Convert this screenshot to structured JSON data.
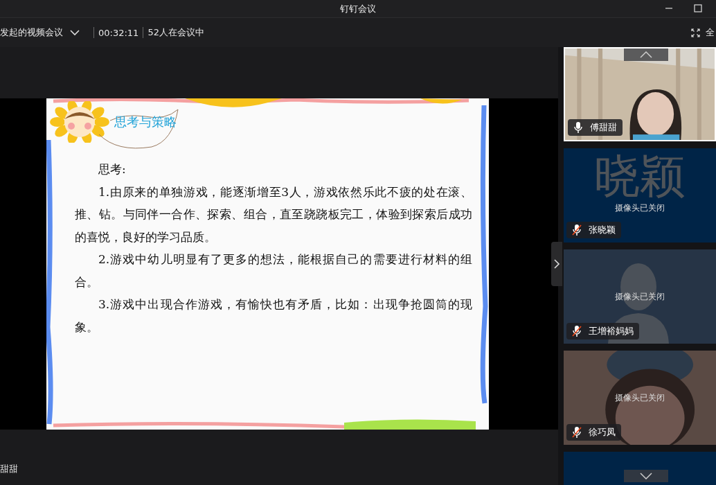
{
  "window": {
    "title": "钉钉会议"
  },
  "toolbar": {
    "meeting_name": "发起的视频会议",
    "duration": "00:32:11",
    "attendees": "52人在会议中",
    "fullscreen_label": "全"
  },
  "slide": {
    "heading": "思考与策略",
    "paragraphs": [
      {
        "text": "思考:"
      },
      {
        "text": "1.由原来的单独游戏，能逐渐增至3人，游戏依然乐此不疲的处在滚、推、钻。与同伴一合作、探索、组合，直至跷跷板完工，体验到探索后成功的喜悦，良好的学习品质。"
      },
      {
        "text": "2.游戏中幼儿明显有了更多的想法，能根据自己的需要进行材料的组合。"
      },
      {
        "text": "3.游戏中出现合作游戏，有愉快也有矛盾，比如：出现争抢圆筒的现象。"
      }
    ]
  },
  "speaker_label": "甜甜",
  "participants": [
    {
      "kind": "video",
      "name": "傅甜甜",
      "muted": false,
      "selected": true
    },
    {
      "kind": "avatar_text",
      "name": "张晓颖",
      "avatar": "晓颖",
      "status": "摄像头已关闭",
      "muted": true,
      "selected": false
    },
    {
      "kind": "silhouette",
      "name": "王增裕妈妈",
      "status": "摄像头已关闭",
      "muted": true,
      "selected": false
    },
    {
      "kind": "blurred_video",
      "name": "徐巧凤",
      "status": "摄像头已关闭",
      "muted": true,
      "selected": false
    },
    {
      "kind": "blank",
      "selected": false
    }
  ]
}
